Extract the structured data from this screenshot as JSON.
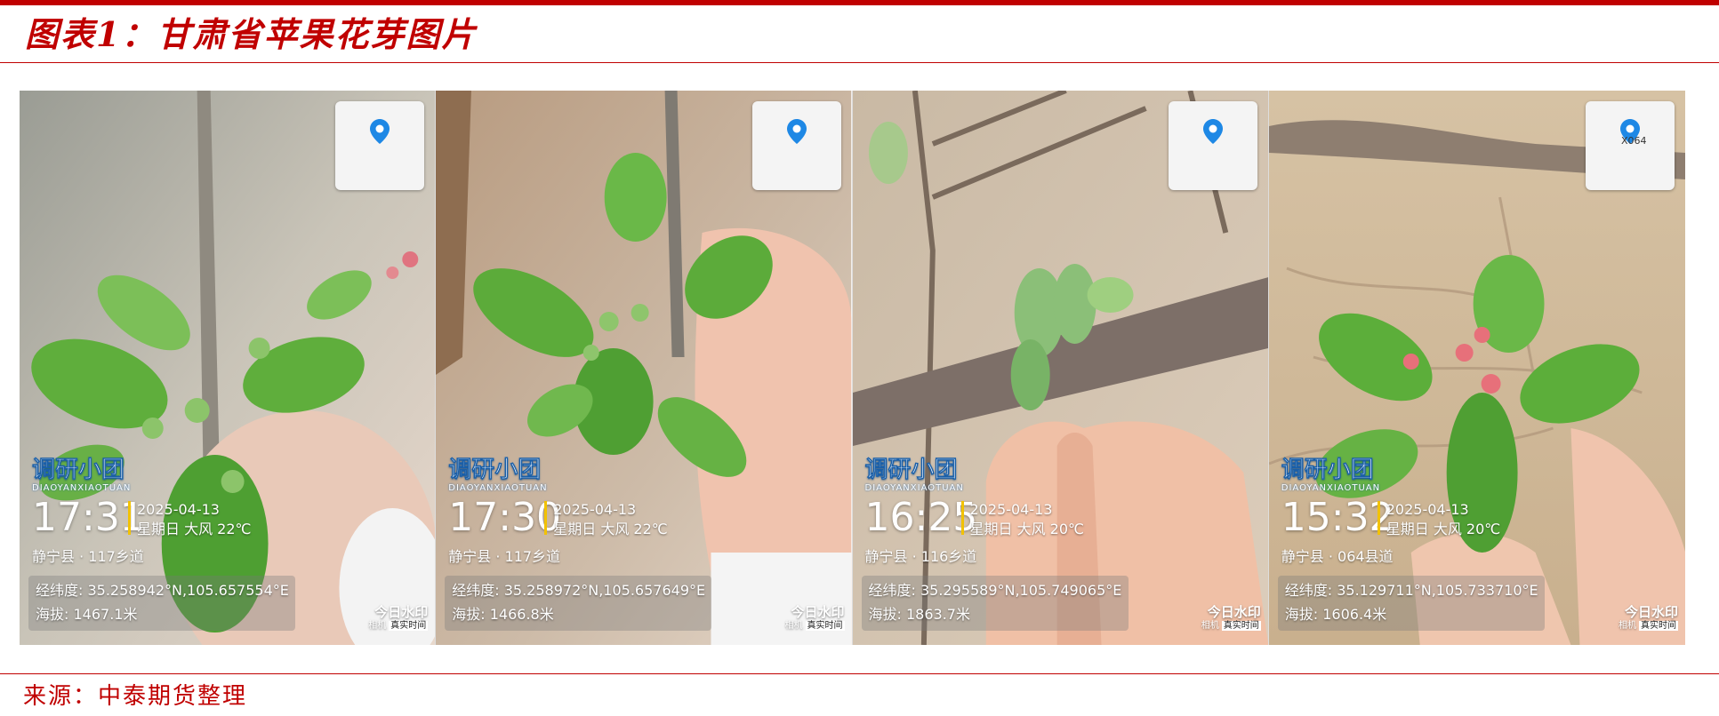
{
  "header": {
    "title": "图表1：甘肃省苹果花芽图片"
  },
  "photos": [
    {
      "map_label": "",
      "brand": "调研小团",
      "brand_pinyin": "DIAOYANXIAOTUAN",
      "time": "17:31",
      "date": "2025-04-13",
      "weekday_weather": "星期日 大风 22℃",
      "place": "静宁县 · 117乡道",
      "coords": "经纬度: 35.258942°N,105.657554°E",
      "altitude": "海拔: 1467.1米",
      "watermark_name": "今日水印",
      "watermark_sub": "相机",
      "watermark_tag": "真实时间"
    },
    {
      "map_label": "",
      "brand": "调研小团",
      "brand_pinyin": "DIAOYANXIAOTUAN",
      "time": "17:30",
      "date": "2025-04-13",
      "weekday_weather": "星期日 大风 22℃",
      "place": "静宁县 · 117乡道",
      "coords": "经纬度: 35.258972°N,105.657649°E",
      "altitude": "海拔: 1466.8米",
      "watermark_name": "今日水印",
      "watermark_sub": "相机",
      "watermark_tag": "真实时间"
    },
    {
      "map_label": "",
      "brand": "调研小团",
      "brand_pinyin": "DIAOYANXIAOTUAN",
      "time": "16:25",
      "date": "2025-04-13",
      "weekday_weather": "星期日 大风 20℃",
      "place": "静宁县 · 116乡道",
      "coords": "经纬度: 35.295589°N,105.749065°E",
      "altitude": "海拔: 1863.7米",
      "watermark_name": "今日水印",
      "watermark_sub": "相机",
      "watermark_tag": "真实时间"
    },
    {
      "map_label": "X064",
      "brand": "调研小团",
      "brand_pinyin": "DIAOYANXIAOTUAN",
      "time": "15:32",
      "date": "2025-04-13",
      "weekday_weather": "星期日 大风 20℃",
      "place": "静宁县 · 064县道",
      "coords": "经纬度: 35.129711°N,105.733710°E",
      "altitude": "海拔: 1606.4米",
      "watermark_name": "今日水印",
      "watermark_sub": "相机",
      "watermark_tag": "真实时间"
    }
  ],
  "footer": {
    "source": "来源：中泰期货整理"
  },
  "colors": {
    "accent": "#c00000",
    "pin": "#1e88e5",
    "time_bar": "#f2c200"
  }
}
